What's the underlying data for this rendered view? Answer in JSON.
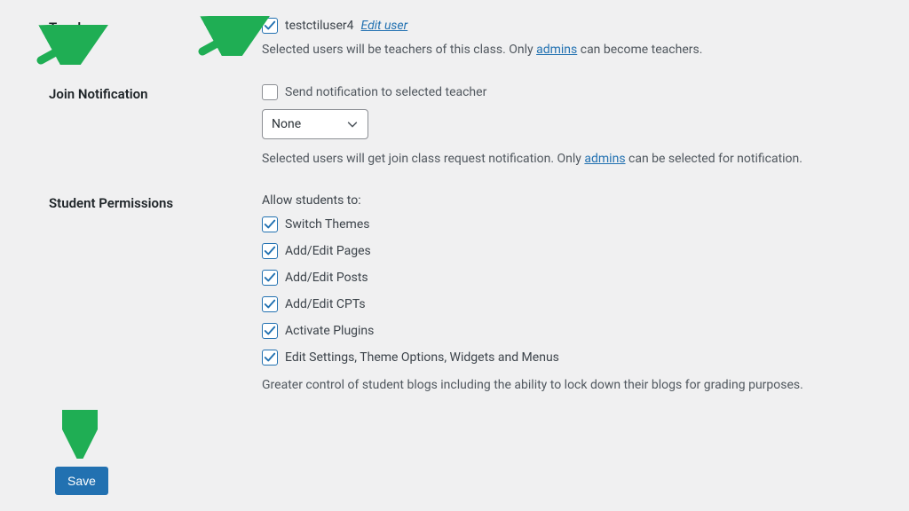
{
  "teachers": {
    "label": "Teachers",
    "user": "testctiluser4",
    "edit_link": "Edit user",
    "checked": true,
    "help_pre": "Selected users will be teachers of this class. Only ",
    "help_link": "admins",
    "help_post": " can become teachers."
  },
  "join_notification": {
    "label": "Join Notification",
    "checkbox_label": "Send notification to selected teacher",
    "checked": false,
    "select_value": "None",
    "help_pre": "Selected users will get join class request notification. Only ",
    "help_link": "admins",
    "help_post": " can be selected for notification."
  },
  "student_permissions": {
    "label": "Student Permissions",
    "intro": "Allow students to:",
    "items": [
      {
        "label": "Switch Themes",
        "checked": true
      },
      {
        "label": "Add/Edit Pages",
        "checked": true
      },
      {
        "label": "Add/Edit Posts",
        "checked": true
      },
      {
        "label": "Add/Edit CPTs",
        "checked": true
      },
      {
        "label": "Activate Plugins",
        "checked": true
      },
      {
        "label": "Edit Settings, Theme Options, Widgets and Menus",
        "checked": true
      }
    ],
    "help": "Greater control of student blogs including the ability to lock down their blogs for grading purposes."
  },
  "save_label": "Save"
}
